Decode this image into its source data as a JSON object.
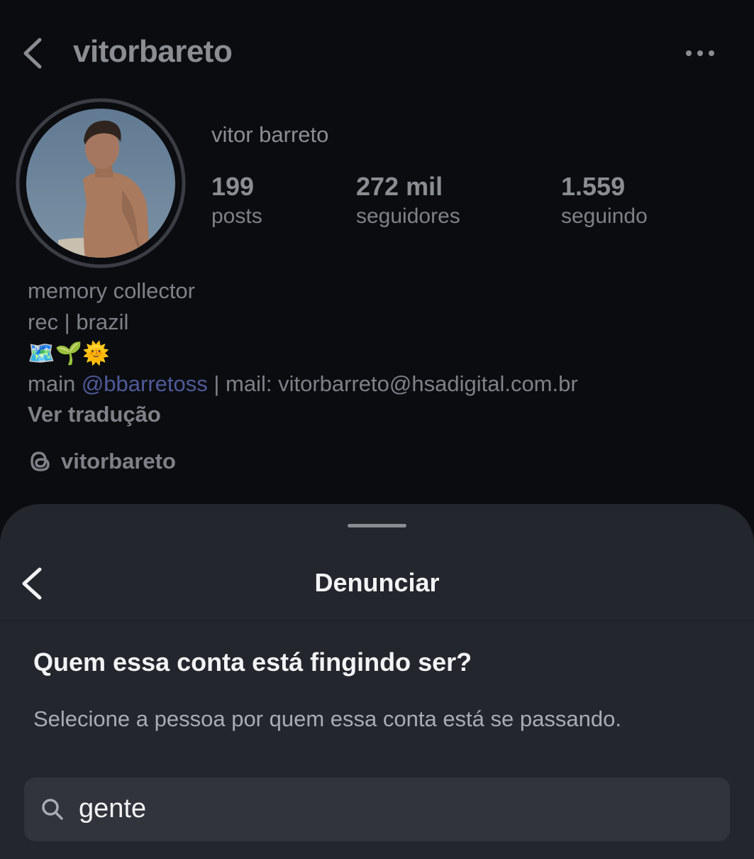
{
  "header": {
    "username": "vitorbareto"
  },
  "profile": {
    "display_name": "vitor barreto",
    "stats": {
      "posts": {
        "value": "199",
        "label": "posts"
      },
      "followers": {
        "value": "272 mil",
        "label": "seguidores"
      },
      "following": {
        "value": "1.559",
        "label": "seguindo"
      }
    },
    "bio": {
      "line1": "memory collector",
      "line2": "rec | brazil",
      "emojis": "🗺️🌱🌞",
      "main_prefix": "main ",
      "mention": "@bbarretoss",
      "mail": " | mail: vitorbarreto@hsadigital.com.br",
      "translate": "Ver tradução"
    },
    "threads_handle": "vitorbareto"
  },
  "sheet": {
    "title": "Denunciar",
    "question": "Quem essa conta está fingindo ser?",
    "subtitle": "Selecione a pessoa por quem essa conta está se passando.",
    "search_value": "gente"
  },
  "icons": {
    "back": "chevron-left-icon",
    "more": "more-horizontal-icon",
    "threads": "threads-icon",
    "search": "search-icon"
  },
  "colors": {
    "background": "#0b0c0f",
    "sheet": "#23262c",
    "search_field": "#31343b",
    "mention": "#4e5a9a"
  }
}
